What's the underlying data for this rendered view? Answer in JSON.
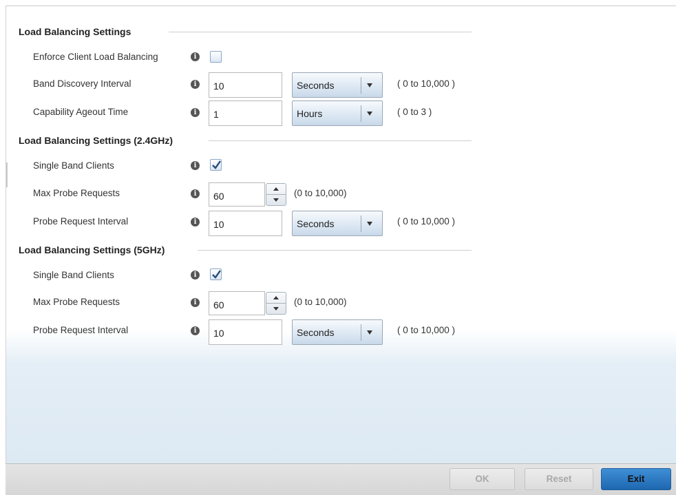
{
  "sections": [
    {
      "title": "Load Balancing Settings",
      "rows": [
        {
          "label": "Enforce Client Load Balancing",
          "checked": false
        },
        {
          "label": "Band Discovery Interval",
          "value": "10",
          "unit": "Seconds",
          "range": "( 0 to 10,000 )"
        },
        {
          "label": "Capability Ageout Time",
          "value": "1",
          "unit": "Hours",
          "range": "( 0 to 3 )"
        }
      ]
    },
    {
      "title": "Load Balancing Settings (2.4GHz)",
      "rows": [
        {
          "label": "Single Band Clients",
          "checked": true
        },
        {
          "label": "Max Probe Requests",
          "value": "60",
          "range": "(0 to 10,000)"
        },
        {
          "label": "Probe Request Interval",
          "value": "10",
          "unit": "Seconds",
          "range": "( 0 to 10,000 )"
        }
      ]
    },
    {
      "title": "Load Balancing Settings (5GHz)",
      "rows": [
        {
          "label": "Single Band Clients",
          "checked": true
        },
        {
          "label": "Max Probe Requests",
          "value": "60",
          "range": "(0 to 10,000)"
        },
        {
          "label": "Probe Request Interval",
          "value": "10",
          "unit": "Seconds",
          "range": "( 0 to 10,000 )"
        }
      ]
    }
  ],
  "info_icon_glyph": "i",
  "footer": {
    "ok_label": "OK",
    "reset_label": "Reset",
    "exit_label": "Exit"
  },
  "colors": {
    "primary_button": "#2a74bf",
    "checkmark": "#2b4f7a",
    "info_icon": "#555555"
  }
}
